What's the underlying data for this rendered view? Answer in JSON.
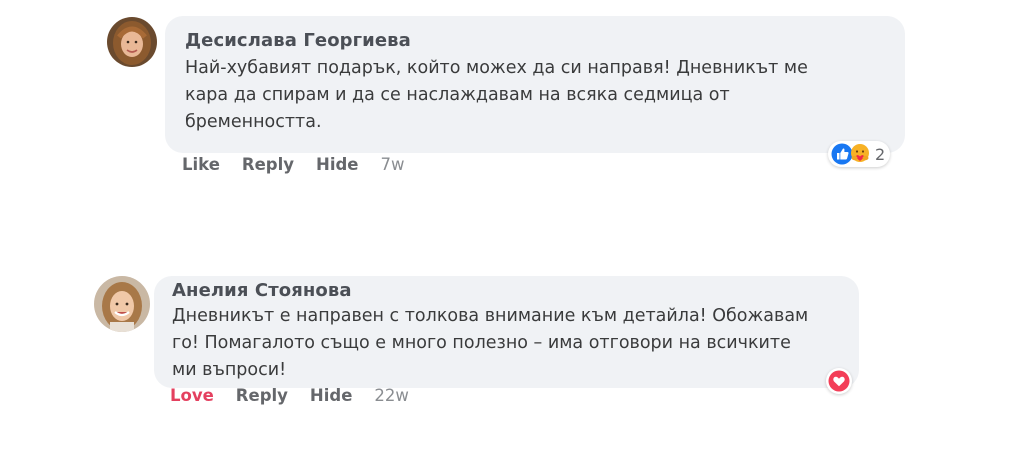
{
  "comments": [
    {
      "author": "Десислава Георгиева",
      "text_lines": [
        "Най-хубавият подарък, който можех да си направя! Дневникът ме",
        "кара да спирам и да се наслаждавам на всяка седмица от",
        "бременността."
      ],
      "actions": {
        "like": "Like",
        "reply": "Reply",
        "hide": "Hide",
        "time": "7w"
      },
      "reactions": {
        "icons": [
          "like-icon",
          "care-icon"
        ],
        "count": "2"
      }
    },
    {
      "author": "Анелия Стоянова",
      "text_lines": [
        "Дневникът е направен с толкова внимание към детайла! Обожавам",
        "го! Помагалото също е много полезно – има отговори на всичките",
        "ми въпроси!"
      ],
      "actions": {
        "like": "Love",
        "reply": "Reply",
        "hide": "Hide",
        "time": "22w"
      },
      "reactions": {
        "icons": [
          "love-icon"
        ],
        "count": ""
      }
    }
  ],
  "colors": {
    "bubble": "#f0f2f5",
    "like_blue": "#1877f2",
    "love_red": "#e4405f",
    "care_yellow": "#f7b125"
  }
}
